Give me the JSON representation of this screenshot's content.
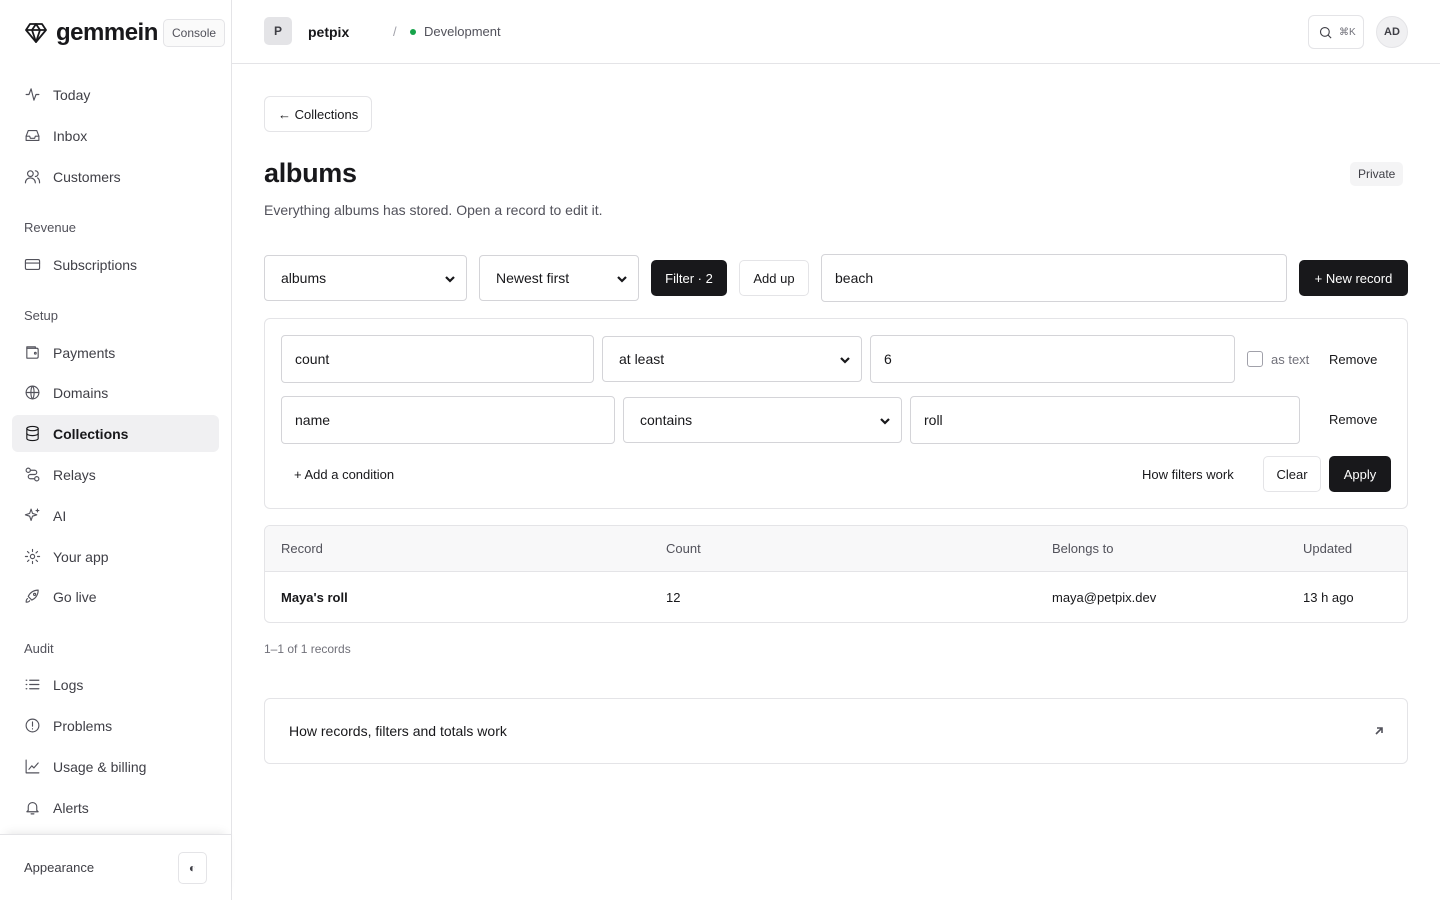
{
  "brand": {
    "name": "gemmein",
    "badge": "Console"
  },
  "sidebar": {
    "items_top": [
      {
        "label": "Today",
        "icon": "activity-icon"
      },
      {
        "label": "Inbox",
        "icon": "inbox-icon"
      },
      {
        "label": "Customers",
        "icon": "users-icon"
      }
    ],
    "sections": {
      "revenue": "Revenue",
      "setup": "Setup",
      "audit": "Audit"
    },
    "revenue_items": [
      {
        "label": "Subscriptions",
        "icon": "credit-card-icon"
      }
    ],
    "setup_items": [
      {
        "label": "Payments",
        "icon": "wallet-icon"
      },
      {
        "label": "Domains",
        "icon": "globe-icon"
      },
      {
        "label": "Collections",
        "icon": "database-icon",
        "active": true
      },
      {
        "label": "Relays",
        "icon": "route-icon"
      },
      {
        "label": "AI",
        "icon": "sparkles-icon"
      },
      {
        "label": "Your app",
        "icon": "gear-icon"
      },
      {
        "label": "Go live",
        "icon": "rocket-icon"
      }
    ],
    "audit_items": [
      {
        "label": "Logs",
        "icon": "list-icon"
      },
      {
        "label": "Problems",
        "icon": "alert-circle-icon"
      },
      {
        "label": "Usage & billing",
        "icon": "chart-icon"
      },
      {
        "label": "Alerts",
        "icon": "bell-icon"
      }
    ],
    "footer": {
      "appearance": "Appearance",
      "toggle": "◐"
    }
  },
  "topbar": {
    "project_initial": "P",
    "project_name": "petpix",
    "separator": "/",
    "environment": "Development",
    "search_shortcut": "⌘K",
    "user_initials": "AD"
  },
  "page": {
    "back": "← Collections",
    "title": "albums",
    "visibility": "Private",
    "description": "Everything albums has stored. Open a record to edit it."
  },
  "toolbar": {
    "collection_select": "albums",
    "sort_select": "Newest first",
    "filter_button": "Filter · 2",
    "add_up_button": "Add up",
    "search_value": "beach",
    "new_record_button": "+ New record"
  },
  "filters": {
    "conditions": [
      {
        "field": "count",
        "operator": "at least",
        "value": "6",
        "as_text_label": "as text",
        "remove": "Remove"
      },
      {
        "field": "name",
        "operator": "contains",
        "value": "roll",
        "remove": "Remove"
      }
    ],
    "add_condition": "+ Add a condition",
    "how_filters_work": "How filters work",
    "clear": "Clear",
    "apply": "Apply"
  },
  "table": {
    "columns": [
      "Record",
      "Count",
      "Belongs to",
      "Updated"
    ],
    "rows": [
      {
        "record": "Maya's roll",
        "count": "12",
        "belongs_to": "maya@petpix.dev",
        "updated": "13 h ago"
      }
    ],
    "summary": "1–1 of 1 records"
  },
  "help": {
    "title": "How records, filters and totals work"
  }
}
